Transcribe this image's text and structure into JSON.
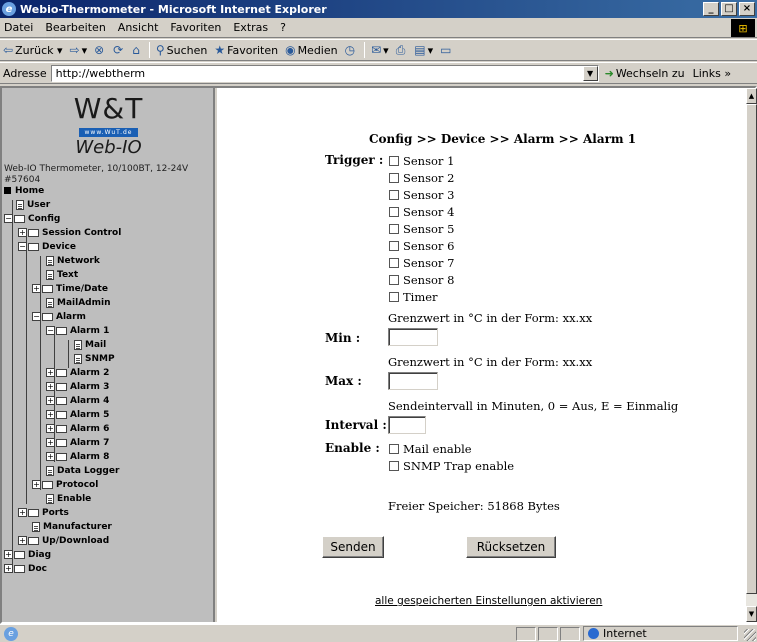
{
  "window": {
    "title": "Webio-Thermometer - Microsoft Internet Explorer"
  },
  "menu": [
    "Datei",
    "Bearbeiten",
    "Ansicht",
    "Favoriten",
    "Extras",
    "?"
  ],
  "toolbar": {
    "back": "Zurück",
    "search": "Suchen",
    "favorites": "Favoriten",
    "media": "Medien"
  },
  "address": {
    "label": "Adresse",
    "value": "http://webtherm",
    "go": "Wechseln zu",
    "links": "Links"
  },
  "nav": {
    "logo_top": "W&T",
    "logo_url": "www.WuT.de",
    "logo_bottom": "Web-IO",
    "device_info_1": "Web-IO Thermometer, 10/100BT, 12-24V",
    "device_info_2": "#57604",
    "items": {
      "home": "Home",
      "user": "User",
      "config": "Config",
      "session_control": "Session Control",
      "device": "Device",
      "network": "Network",
      "text": "Text",
      "time_date": "Time/Date",
      "mailadmin": "MailAdmin",
      "alarm": "Alarm",
      "alarm1": "Alarm 1",
      "mail": "Mail",
      "snmp": "SNMP",
      "alarm2": "Alarm 2",
      "alarm3": "Alarm 3",
      "alarm4": "Alarm 4",
      "alarm5": "Alarm 5",
      "alarm6": "Alarm 6",
      "alarm7": "Alarm 7",
      "alarm8": "Alarm 8",
      "data_logger": "Data Logger",
      "protocol": "Protocol",
      "enable": "Enable",
      "ports": "Ports",
      "manufacturer": "Manufacturer",
      "updownload": "Up/Download",
      "diag": "Diag",
      "doc": "Doc"
    }
  },
  "form": {
    "breadcrumb": "Config >> Device >> Alarm >> Alarm 1",
    "trigger_label": "Trigger :",
    "sensors": [
      "Sensor 1",
      "Sensor 2",
      "Sensor 3",
      "Sensor 4",
      "Sensor 5",
      "Sensor 6",
      "Sensor 7",
      "Sensor 8"
    ],
    "timer": "Timer",
    "min_hint": "Grenzwert in °C in der Form: xx.xx",
    "min_label": "Min :",
    "max_hint": "Grenzwert in °C in der Form: xx.xx",
    "max_label": "Max :",
    "interval_hint": "Sendeintervall in Minuten, 0 = Aus, E = Einmalig",
    "interval_label": "Interval :",
    "enable_label": "Enable :",
    "mail_enable": "Mail enable",
    "snmp_enable": "SNMP Trap enable",
    "free_memory": "Freier Speicher: 51868 Bytes",
    "submit": "Senden",
    "reset": "Rücksetzen",
    "activate_link": "alle gespeicherten Einstellungen aktivieren"
  },
  "status": {
    "zone": "Internet"
  }
}
